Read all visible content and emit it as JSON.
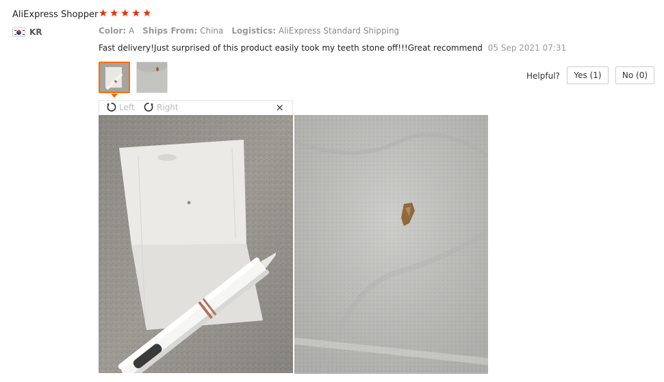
{
  "review": {
    "username": "AliExpress Shopper",
    "rating": 5,
    "country_code": "KR",
    "attributes": [
      {
        "key": "Color:",
        "value": "A"
      },
      {
        "key": "Ships From:",
        "value": "China"
      },
      {
        "key": "Logistics:",
        "value": "AliExpress Standard Shipping"
      }
    ],
    "text": "Fast delivery!Just surprised of this product easily took my teeth stone off!!!Great recommend",
    "date": "05 Sep 2021 07:31"
  },
  "helpful": {
    "label": "Helpful?",
    "yes": "Yes (1)",
    "no": "No (0)"
  },
  "viewer": {
    "rotate_left": "Left",
    "rotate_right": "Right",
    "close": "×"
  },
  "icons": {
    "star": "star-icon",
    "rotate_left": "rotate-left-icon",
    "rotate_right": "rotate-right-icon",
    "close": "close-icon"
  },
  "colors": {
    "star": "#e62e04",
    "thumb_active": "#ff6a00"
  }
}
